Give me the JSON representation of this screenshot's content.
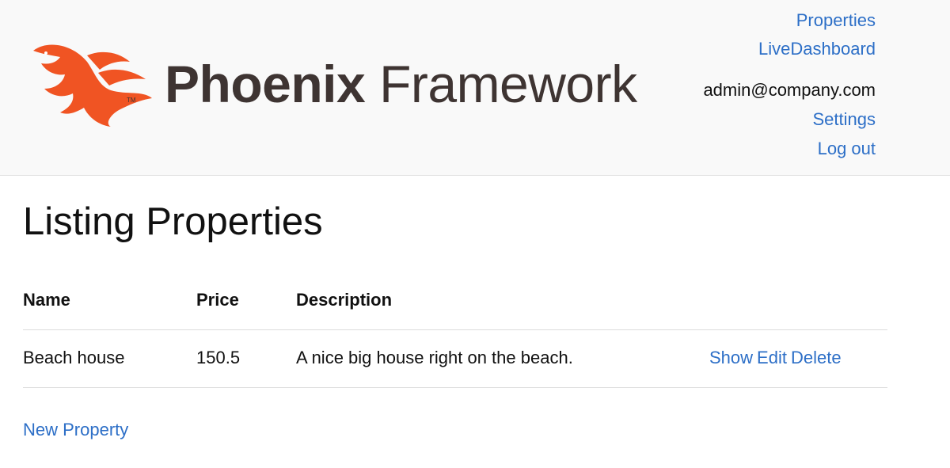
{
  "brand": {
    "name_bold": "Phoenix",
    "name_light": "Framework",
    "logo_color": "#f05423",
    "text_color": "#3e3432",
    "trademark": "TM"
  },
  "nav": {
    "properties": "Properties",
    "live_dashboard": "LiveDashboard",
    "user_email": "admin@company.com",
    "settings": "Settings",
    "log_out": "Log out"
  },
  "page": {
    "title": "Listing Properties"
  },
  "table": {
    "headers": [
      "Name",
      "Price",
      "Description"
    ],
    "rows": [
      {
        "name": "Beach house",
        "price": "150.5",
        "description": "A nice big house right on the beach.",
        "actions": [
          "Show",
          "Edit",
          "Delete"
        ]
      }
    ]
  },
  "footer": {
    "new_link": "New Property"
  },
  "colors": {
    "link": "#2d6fc7",
    "header_bg": "#f9f9f9",
    "divider": "#dcdcdc"
  }
}
